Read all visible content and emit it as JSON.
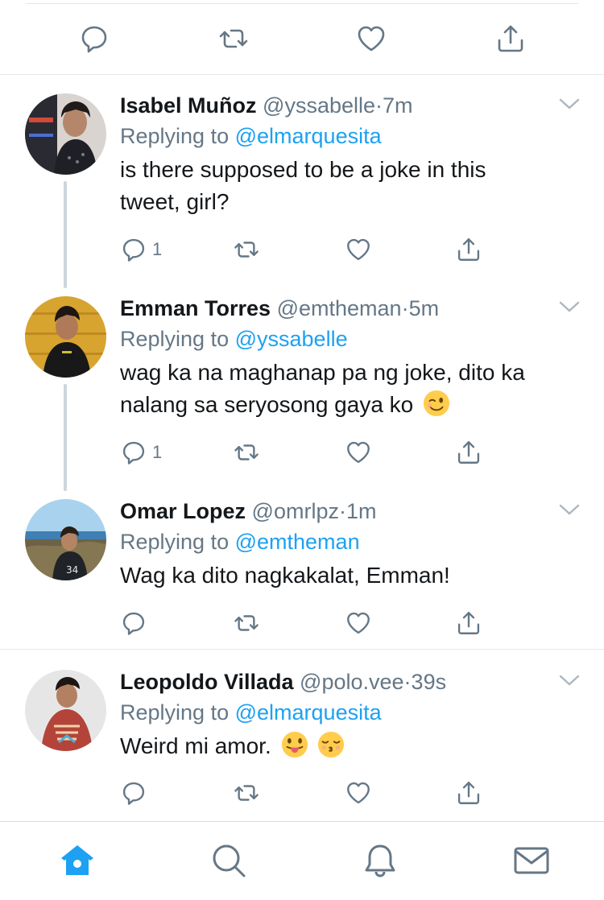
{
  "colors": {
    "accent": "#1da1f2",
    "secondary_text": "#657786",
    "primary_text": "#14171a",
    "divider": "#e1e8ed"
  },
  "top_actions": [
    "reply-icon",
    "retweet-icon",
    "like-icon",
    "share-icon"
  ],
  "tweets": [
    {
      "name": "Isabel Muñoz",
      "handle": "@yssabelle",
      "time": "7m",
      "replying_prefix": "Replying to",
      "replying_to": "@elmarquesita",
      "body_line1": "is there supposed to be a joke in this",
      "body_line2": "tweet, girl?",
      "reply_count": "1"
    },
    {
      "name": "Emman Torres",
      "handle": "@emtheman",
      "time": "5m",
      "replying_prefix": "Replying to",
      "replying_to": "@yssabelle",
      "body_line1": "wag ka na maghanap pa ng joke, dito ka",
      "body_line2": "nalang sa seryosong gaya ko",
      "emoji": "winking-face",
      "reply_count": "1"
    },
    {
      "name": "Omar Lopez",
      "handle": "@omrlpz",
      "time": "1m",
      "replying_prefix": "Replying to",
      "replying_to": "@emtheman",
      "body_line1": "Wag ka dito nagkakalat, Emman!"
    },
    {
      "name": "Leopoldo Villada",
      "handle": "@polo.vee",
      "time": "39s",
      "replying_prefix": "Replying to",
      "replying_to": "@elmarquesita",
      "body_line1": "Weird mi amor.",
      "emojis": [
        "tongue-face",
        "kissing-face"
      ]
    }
  ],
  "dot": "·",
  "tabbar": [
    {
      "icon": "home-icon",
      "active": true
    },
    {
      "icon": "search-icon",
      "active": false
    },
    {
      "icon": "bell-icon",
      "active": false
    },
    {
      "icon": "mail-icon",
      "active": false
    }
  ]
}
